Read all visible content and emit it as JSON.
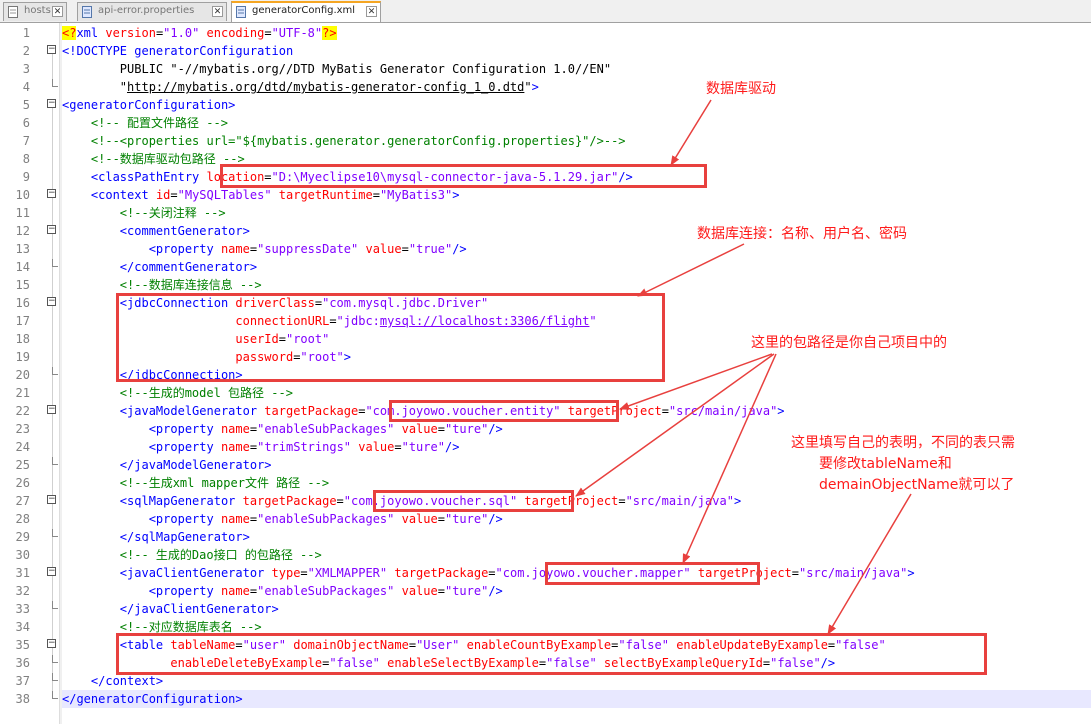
{
  "tabs": [
    {
      "label": "hosts"
    },
    {
      "label": "api-error.properties"
    },
    {
      "label": "generatorConfig.xml"
    }
  ],
  "editor": {
    "line_numbers": [
      "1",
      "2",
      "3",
      "4",
      "5",
      "6",
      "7",
      "8",
      "9",
      "10",
      "11",
      "12",
      "13",
      "14",
      "15",
      "16",
      "17",
      "18",
      "19",
      "20",
      "21",
      "22",
      "23",
      "24",
      "25",
      "26",
      "27",
      "28",
      "29",
      "30",
      "31",
      "32",
      "33",
      "34",
      "35",
      "36",
      "37",
      "38"
    ],
    "lines": [
      [
        [
          "pi",
          "<?"
        ],
        [
          "tag",
          "xml "
        ],
        [
          "attr",
          "version"
        ],
        [
          "txt",
          "="
        ],
        [
          "val",
          "\"1.0\""
        ],
        [
          "txt",
          " "
        ],
        [
          "attr",
          "encoding"
        ],
        [
          "txt",
          "="
        ],
        [
          "val",
          "\"UTF-8\""
        ],
        [
          "pi",
          "?>"
        ]
      ],
      [
        [
          "tag",
          "<!DOCTYPE generatorConfiguration"
        ]
      ],
      [
        [
          "txt",
          "        PUBLIC \"-//mybatis.org//DTD MyBatis Generator Configuration 1.0//EN\""
        ]
      ],
      [
        [
          "txt",
          "        \""
        ],
        [
          "ul",
          "http://mybatis.org/dtd/mybatis-generator-config_1_0.dtd"
        ],
        [
          "txt",
          "\""
        ],
        [
          "tag",
          ">"
        ]
      ],
      [
        [
          "tag",
          "<generatorConfiguration>"
        ]
      ],
      [
        [
          "txt",
          "    "
        ],
        [
          "cmt",
          "<!-- 配置文件路径 -->"
        ]
      ],
      [
        [
          "txt",
          "    "
        ],
        [
          "cmt",
          "<!--<properties url=\"${mybatis.generator.generatorConfig.properties}\"/>-->"
        ]
      ],
      [
        [
          "txt",
          "    "
        ],
        [
          "cmt",
          "<!--数据库驱动包路径 -->"
        ]
      ],
      [
        [
          "txt",
          "    "
        ],
        [
          "tag",
          "<classPathEntry "
        ],
        [
          "attr",
          "location"
        ],
        [
          "txt",
          "="
        ],
        [
          "val",
          "\"D:\\Myeclipse10\\mysql-connector-java-5.1.29.jar\""
        ],
        [
          "tag",
          "/>"
        ]
      ],
      [
        [
          "txt",
          "    "
        ],
        [
          "tag",
          "<context "
        ],
        [
          "attr",
          "id"
        ],
        [
          "txt",
          "="
        ],
        [
          "val",
          "\"MySQLTables\""
        ],
        [
          "txt",
          " "
        ],
        [
          "attr",
          "targetRuntime"
        ],
        [
          "txt",
          "="
        ],
        [
          "val",
          "\"MyBatis3\""
        ],
        [
          "tag",
          ">"
        ]
      ],
      [
        [
          "txt",
          "        "
        ],
        [
          "cmt",
          "<!--关闭注释 -->"
        ]
      ],
      [
        [
          "txt",
          "        "
        ],
        [
          "tag",
          "<commentGenerator>"
        ]
      ],
      [
        [
          "txt",
          "            "
        ],
        [
          "tag",
          "<property "
        ],
        [
          "attr",
          "name"
        ],
        [
          "txt",
          "="
        ],
        [
          "val",
          "\"suppressDate\""
        ],
        [
          "txt",
          " "
        ],
        [
          "attr",
          "value"
        ],
        [
          "txt",
          "="
        ],
        [
          "val",
          "\"true\""
        ],
        [
          "tag",
          "/>"
        ]
      ],
      [
        [
          "txt",
          "        "
        ],
        [
          "tag",
          "</commentGenerator>"
        ]
      ],
      [
        [
          "txt",
          "        "
        ],
        [
          "cmt",
          "<!--数据库连接信息 -->"
        ]
      ],
      [
        [
          "txt",
          "        "
        ],
        [
          "tag",
          "<jdbcConnection "
        ],
        [
          "attr",
          "driverClass"
        ],
        [
          "txt",
          "="
        ],
        [
          "val",
          "\"com.mysql.jdbc.Driver\""
        ]
      ],
      [
        [
          "txt",
          "                        "
        ],
        [
          "attr",
          "connectionURL"
        ],
        [
          "txt",
          "="
        ],
        [
          "val",
          "\"jdbc:"
        ],
        [
          "valul",
          "mysql://localhost:3306/flight"
        ],
        [
          "val",
          "\""
        ]
      ],
      [
        [
          "txt",
          "                        "
        ],
        [
          "attr",
          "userId"
        ],
        [
          "txt",
          "="
        ],
        [
          "val",
          "\"root\""
        ]
      ],
      [
        [
          "txt",
          "                        "
        ],
        [
          "attr",
          "password"
        ],
        [
          "txt",
          "="
        ],
        [
          "val",
          "\"root\""
        ],
        [
          "tag",
          ">"
        ]
      ],
      [
        [
          "txt",
          "        "
        ],
        [
          "tag",
          "</jdbcConnection>"
        ]
      ],
      [
        [
          "txt",
          "        "
        ],
        [
          "cmt",
          "<!--生成的model 包路径 -->"
        ]
      ],
      [
        [
          "txt",
          "        "
        ],
        [
          "tag",
          "<javaModelGenerator "
        ],
        [
          "attr",
          "targetPackage"
        ],
        [
          "txt",
          "="
        ],
        [
          "val",
          "\"com.joyowo.voucher.entity\""
        ],
        [
          "txt",
          " "
        ],
        [
          "attr",
          "targetProject"
        ],
        [
          "txt",
          "="
        ],
        [
          "val",
          "\"src/main/java\""
        ],
        [
          "tag",
          ">"
        ]
      ],
      [
        [
          "txt",
          "            "
        ],
        [
          "tag",
          "<property "
        ],
        [
          "attr",
          "name"
        ],
        [
          "txt",
          "="
        ],
        [
          "val",
          "\"enableSubPackages\""
        ],
        [
          "txt",
          " "
        ],
        [
          "attr",
          "value"
        ],
        [
          "txt",
          "="
        ],
        [
          "val",
          "\"ture\""
        ],
        [
          "tag",
          "/>"
        ]
      ],
      [
        [
          "txt",
          "            "
        ],
        [
          "tag",
          "<property "
        ],
        [
          "attr",
          "name"
        ],
        [
          "txt",
          "="
        ],
        [
          "val",
          "\"trimStrings\""
        ],
        [
          "txt",
          " "
        ],
        [
          "attr",
          "value"
        ],
        [
          "txt",
          "="
        ],
        [
          "val",
          "\"ture\""
        ],
        [
          "tag",
          "/>"
        ]
      ],
      [
        [
          "txt",
          "        "
        ],
        [
          "tag",
          "</javaModelGenerator>"
        ]
      ],
      [
        [
          "txt",
          "        "
        ],
        [
          "cmt",
          "<!--生成xml mapper文件 路径 -->"
        ]
      ],
      [
        [
          "txt",
          "        "
        ],
        [
          "tag",
          "<sqlMapGenerator "
        ],
        [
          "attr",
          "targetPackage"
        ],
        [
          "txt",
          "="
        ],
        [
          "val",
          "\"com.joyowo.voucher.sql\""
        ],
        [
          "txt",
          " "
        ],
        [
          "attr",
          "targetProject"
        ],
        [
          "txt",
          "="
        ],
        [
          "val",
          "\"src/main/java\""
        ],
        [
          "tag",
          ">"
        ]
      ],
      [
        [
          "txt",
          "            "
        ],
        [
          "tag",
          "<property "
        ],
        [
          "attr",
          "name"
        ],
        [
          "txt",
          "="
        ],
        [
          "val",
          "\"enableSubPackages\""
        ],
        [
          "txt",
          " "
        ],
        [
          "attr",
          "value"
        ],
        [
          "txt",
          "="
        ],
        [
          "val",
          "\"ture\""
        ],
        [
          "tag",
          "/>"
        ]
      ],
      [
        [
          "txt",
          "        "
        ],
        [
          "tag",
          "</sqlMapGenerator>"
        ]
      ],
      [
        [
          "txt",
          "        "
        ],
        [
          "cmt",
          "<!-- 生成的Dao接口 的包路径 -->"
        ]
      ],
      [
        [
          "txt",
          "        "
        ],
        [
          "tag",
          "<javaClientGenerator "
        ],
        [
          "attr",
          "type"
        ],
        [
          "txt",
          "="
        ],
        [
          "val",
          "\"XMLMAPPER\""
        ],
        [
          "txt",
          " "
        ],
        [
          "attr",
          "targetPackage"
        ],
        [
          "txt",
          "="
        ],
        [
          "val",
          "\"com.joyowo.voucher.mapper\""
        ],
        [
          "txt",
          " "
        ],
        [
          "attr",
          "targetProject"
        ],
        [
          "txt",
          "="
        ],
        [
          "val",
          "\"src/main/java\""
        ],
        [
          "tag",
          ">"
        ]
      ],
      [
        [
          "txt",
          "            "
        ],
        [
          "tag",
          "<property "
        ],
        [
          "attr",
          "name"
        ],
        [
          "txt",
          "="
        ],
        [
          "val",
          "\"enableSubPackages\""
        ],
        [
          "txt",
          " "
        ],
        [
          "attr",
          "value"
        ],
        [
          "txt",
          "="
        ],
        [
          "val",
          "\"ture\""
        ],
        [
          "tag",
          "/>"
        ]
      ],
      [
        [
          "txt",
          "        "
        ],
        [
          "tag",
          "</javaClientGenerator>"
        ]
      ],
      [
        [
          "txt",
          "        "
        ],
        [
          "cmt",
          "<!--对应数据库表名 -->"
        ]
      ],
      [
        [
          "txt",
          "        "
        ],
        [
          "tag",
          "<table "
        ],
        [
          "attr",
          "tableName"
        ],
        [
          "txt",
          "="
        ],
        [
          "val",
          "\"user\""
        ],
        [
          "txt",
          " "
        ],
        [
          "attr",
          "domainObjectName"
        ],
        [
          "txt",
          "="
        ],
        [
          "val",
          "\"User\""
        ],
        [
          "txt",
          " "
        ],
        [
          "attr",
          "enableCountByExample"
        ],
        [
          "txt",
          "="
        ],
        [
          "val",
          "\"false\""
        ],
        [
          "txt",
          " "
        ],
        [
          "attr",
          "enableUpdateByExample"
        ],
        [
          "txt",
          "="
        ],
        [
          "val",
          "\"false\""
        ]
      ],
      [
        [
          "txt",
          "               "
        ],
        [
          "attr",
          "enableDeleteByExample"
        ],
        [
          "txt",
          "="
        ],
        [
          "val",
          "\"false\""
        ],
        [
          "txt",
          " "
        ],
        [
          "attr",
          "enableSelectByExample"
        ],
        [
          "txt",
          "="
        ],
        [
          "val",
          "\"false\""
        ],
        [
          "txt",
          " "
        ],
        [
          "attr",
          "selectByExampleQueryId"
        ],
        [
          "txt",
          "="
        ],
        [
          "val",
          "\"false\""
        ],
        [
          "tag",
          "/>"
        ]
      ],
      [
        [
          "txt",
          "    "
        ],
        [
          "tag",
          "</context>"
        ]
      ],
      [
        [
          "tag",
          "</generatorConfiguration>"
        ]
      ]
    ]
  },
  "annotations": {
    "driver": "数据库驱动",
    "connection": "数据库连接：名称、用户名、密码",
    "package": "这里的包路径是你自己项目中的",
    "table_line1": "这里填写自己的表明，不同的表只需",
    "table_line2": "要修改tableName和",
    "table_line3": "demainObjectName就可以了"
  },
  "colors": {
    "annotation": "#e8403e",
    "tag": "#0000ff",
    "attribute": "#ff0000",
    "value": "#8000ff",
    "comment": "#008000"
  }
}
